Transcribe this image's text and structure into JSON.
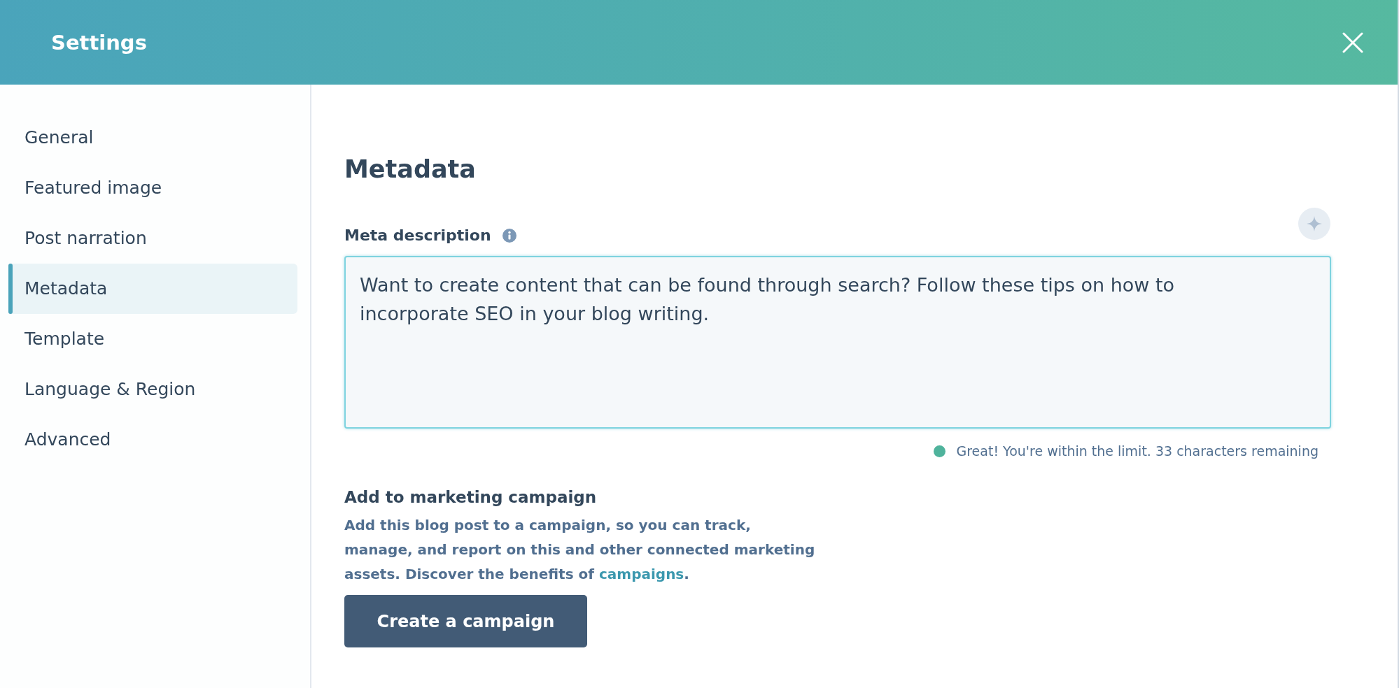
{
  "window": {
    "title": "Settings"
  },
  "sidebar": {
    "items": [
      {
        "label": "General",
        "selected": false
      },
      {
        "label": "Featured image",
        "selected": false
      },
      {
        "label": "Post narration",
        "selected": false
      },
      {
        "label": "Metadata",
        "selected": true
      },
      {
        "label": "Template",
        "selected": false
      },
      {
        "label": "Language & Region",
        "selected": false
      },
      {
        "label": "Advanced",
        "selected": false
      }
    ]
  },
  "section": {
    "title": "Metadata",
    "meta_description": {
      "label": "Meta description",
      "value": "Want to create content that can be found through search? Follow these tips on how to incorporate SEO in your blog writing.",
      "status": {
        "kind": "success",
        "text": "Great! You're within the limit. 33 characters remaining"
      }
    },
    "campaign": {
      "title": "Add to marketing campaign",
      "description": "Add this blog post to a campaign, so you can track, manage, and report on this and other connected marketing assets. Discover the benefits of",
      "link": "campaigns",
      "link_suffix": ".",
      "button": "Create a campaign"
    }
  }
}
